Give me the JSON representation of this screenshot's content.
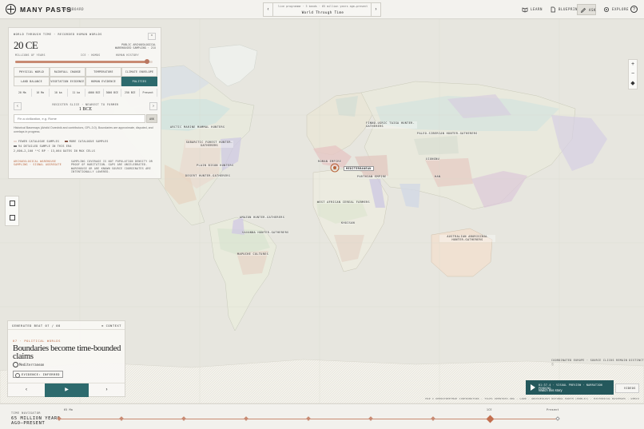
{
  "app": {
    "brand": "MANY PASTS",
    "back_label": "‹  DASHBOARD"
  },
  "chronicle": {
    "meta": "live programme · 3 bands · 65 million years age–present",
    "title": "World Through Time"
  },
  "top_nav": {
    "learn": "LEARN",
    "blueprint": "BLUEPRINT",
    "ask": "ASK",
    "explore": "EXPLORE",
    "help": "?"
  },
  "panel": {
    "breadcrumb": "WORLD THROUGH TIME · RECORDED HUMAN WORLDS",
    "year": "20 CE",
    "era_tag": [
      "PUBLIC ARCHAEOLOGICAL",
      "WAREHOUSED SAMPLING · 21X"
    ],
    "slider_labels": [
      "MILLIONS OF YEARS",
      "ICE · HOMOS",
      "HUMAN HISTORY"
    ],
    "slider_value": 0.96,
    "layers": [
      "PHYSICAL WORLD",
      "RAINFALL CHANGE",
      "TEMPERATURE",
      "CLIMATE ENVELOPE",
      "LAND BALANCE",
      "VEGETATION EVIDENCE",
      "HUMAN EVIDENCE",
      "POLITIES"
    ],
    "active_layer": "POLITIES",
    "ticks": [
      "20 Ma",
      "16 Ma",
      "10 ka",
      "11 ka",
      "4000 BCE",
      "3000 BCE",
      "250 BCE",
      "Present"
    ],
    "region_nav_label": "REGISTER SLICE · NEAREST TO FORMER",
    "region_year": "1 BCE",
    "search_placeholder": "Fin a civilization, e.g. Rome",
    "search_go": "ASK",
    "search_note": "Historical Basemaps (Aristid Ourednik and contributors, GPL-3.0). Boundaries are approximate, disputed, and overlaps in progress.",
    "legend": [
      "FEWER CATALOGUE SAMPLES",
      "MORE CATALOGUE SAMPLES",
      "94 DETAILED SAMPLE IN THIS ERA",
      "2,600–2,100 ¹⁴C BP · 13,064 DATES IN MAX CELLS"
    ],
    "note_left": "ARCHAEOLOGICAL WAREHOUSE SAMPLING · SIGNAL AGGREGATE",
    "note_right": "SAMPLING COVERAGE IS NOT POPULATION DENSITY OR PROOF OF HABITATION. GAPS ARE UNCELEBRATED. WAREHOUSE OR ARE KNOWN SOURCE COORDINATES ARE INTENTIONALLY LOWERED."
  },
  "map_labels": [
    "ARCTIC MARINE MAMMAL HUNTERS",
    "FINNO-UGRIC TAIGA HUNTER-GATHERERS",
    "PALEO-SIBERIAN HUNTER-GATHERERS",
    "SUBARCTIC FOREST HUNTER-GATHERERS",
    "PLAIN BISON HUNTERS",
    "DESERT HUNTER-GATHERERS",
    "ROMAN EMPIRE",
    "PARTHIAN EMPIRE",
    "XIONGNU",
    "HAN",
    "MEDITERRANEAN",
    "WEST AFRICAN CEREAL FARMERS",
    "AMAZON HUNTER-GATHERERS",
    "SAVANNA HUNTER-GATHERERS",
    "KHOISAN",
    "AUSTRALIAN ABORIGINAL HUNTER-GATHERERS",
    "MAPUCHE CULTURES"
  ],
  "zoom": {
    "in": "+",
    "out": "−",
    "reset": "◆"
  },
  "story": {
    "generated": "GENERATED BEAT 07 / 08",
    "context": "≡ CONTEXT",
    "kicker": "07 · POLITICAL WORLDS",
    "title": "Boundaries become time-bounded claims",
    "location": "Mediterranean",
    "evidence": "EVIDENCE: INFERRED",
    "prev": "‹",
    "play": "▶",
    "next": "›"
  },
  "coords_readout": "COORDINATED EUROPE · SOURCE CLICKS REMAIN DISTINCT ⓘ",
  "narration": {
    "meta": "01:37.4 · VISUAL PREVIEW · NARRATION PENDING",
    "title": "Watch this story"
  },
  "videos_label": "VIDEOS",
  "credits": "MAP © OPENSTREETMAP CONTRIBUTORS · TILES OPENTOPO.ORG · LAND · ARCHAEOLOGY NATURAL EARTH (PUBLIC) · HISTORICAL BASEMAPS · GEBCO",
  "timeline": {
    "label": "TIME NAVIGATOR",
    "range": [
      "65 MILLION YEARS",
      "AGO—PRESENT"
    ],
    "tick_left": "65 Ma",
    "tick_current": "1CE",
    "tick_right": "Present",
    "events": [
      0.0,
      0.125,
      0.25,
      0.375,
      0.5,
      0.625,
      0.75,
      0.865,
      1.0
    ],
    "current": 0.865
  },
  "colors": {
    "accent": "#2d6a6d",
    "clay": "#c88a72",
    "land": "#e9e6d8",
    "water": "#e7e6df"
  }
}
